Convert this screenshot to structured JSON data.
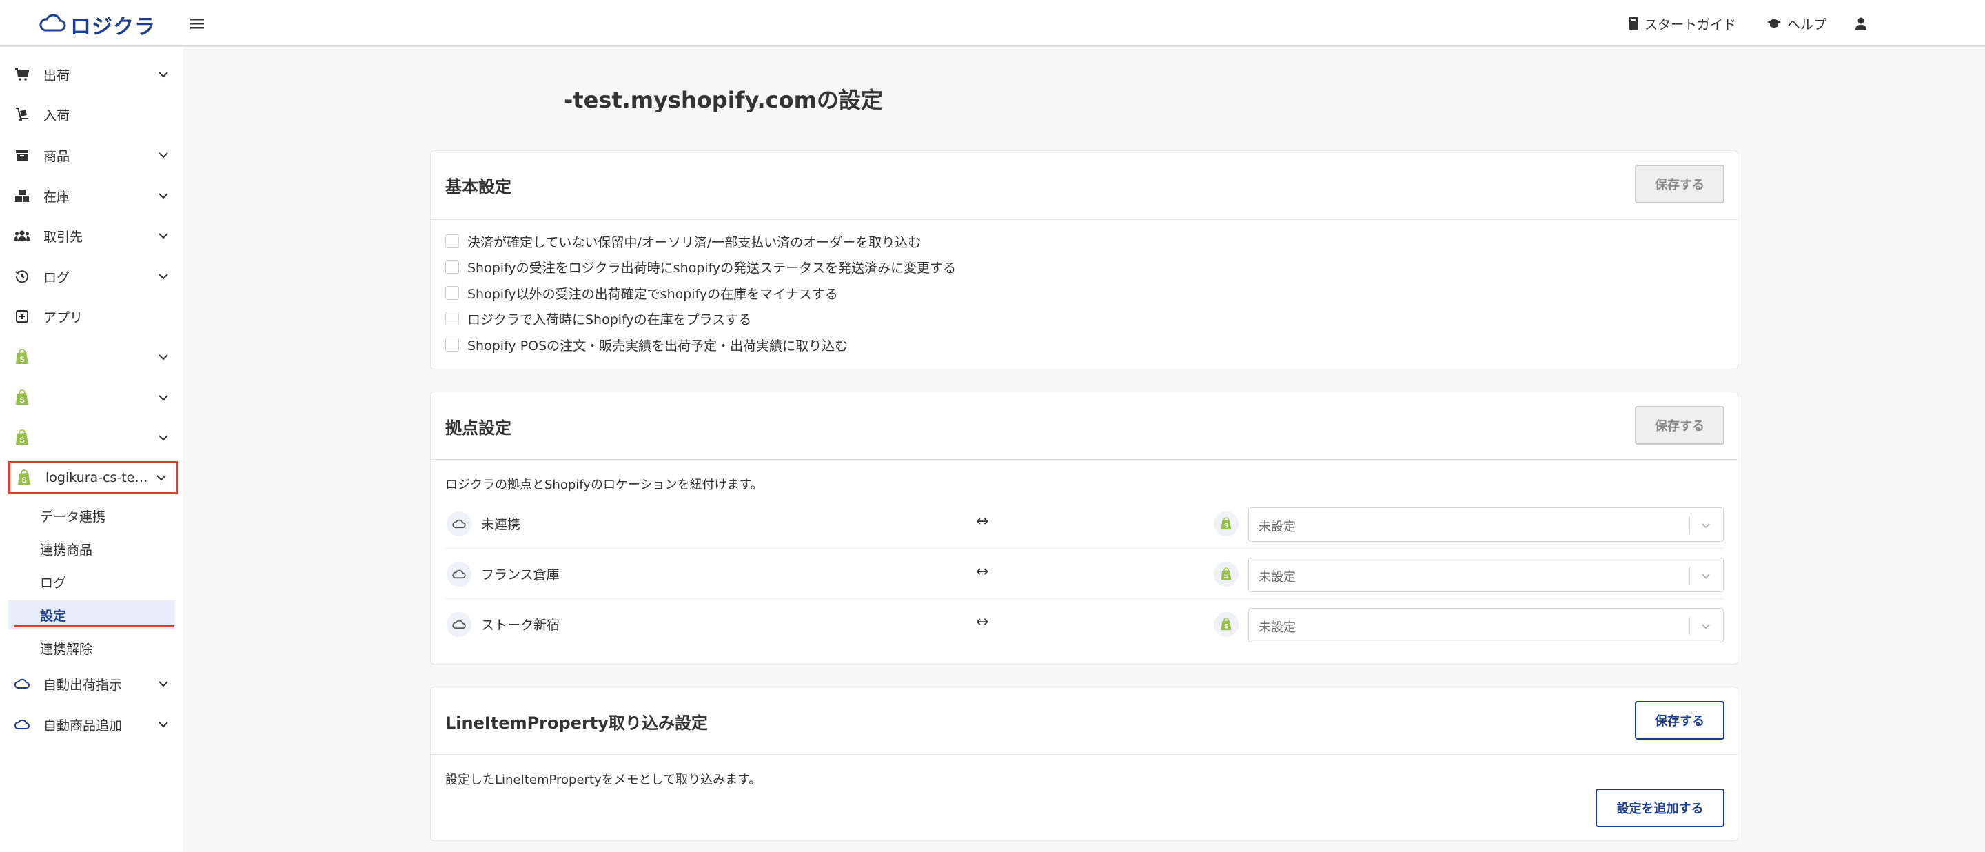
{
  "header": {
    "logo_text": "ロジクラ",
    "start_guide": "スタートガイド",
    "help": "ヘルプ"
  },
  "sidebar": {
    "items": [
      {
        "label": "出荷",
        "icon": "cart-icon",
        "chevron": true
      },
      {
        "label": "入荷",
        "icon": "dolly-icon",
        "chevron": false
      },
      {
        "label": "商品",
        "icon": "archive-box-icon",
        "chevron": true
      },
      {
        "label": "在庫",
        "icon": "boxes-icon",
        "chevron": true
      },
      {
        "label": "取引先",
        "icon": "people-icon",
        "chevron": true
      },
      {
        "label": "ログ",
        "icon": "history-icon",
        "chevron": true
      },
      {
        "label": "アプリ",
        "icon": "plus-square-icon",
        "chevron": false
      },
      {
        "label": "",
        "icon": "shopify-icon",
        "chevron": true
      },
      {
        "label": "",
        "icon": "shopify-icon",
        "chevron": true
      },
      {
        "label": "",
        "icon": "shopify-icon",
        "chevron": true
      },
      {
        "label": "logikura-cs-te…",
        "icon": "shopify-icon",
        "chevron": true
      }
    ],
    "sub_items": [
      "データ連携",
      "連携商品",
      "ログ",
      "設定",
      "連携解除"
    ],
    "bottom_items": [
      {
        "label": "自動出荷指示",
        "icon": "cloud-icon"
      },
      {
        "label": "自動商品追加",
        "icon": "cloud-icon"
      }
    ]
  },
  "page": {
    "title": "-test.myshopify.comの設定"
  },
  "basic": {
    "title": "基本設定",
    "save": "保存する",
    "options": [
      "決済が確定していない保留中/オーソリ済/一部支払い済のオーダーを取り込む",
      "Shopifyの受注をロジクラ出荷時にshopifyの発送ステータスを発送済みに変更する",
      "Shopify以外の受注の出荷確定でshopifyの在庫をマイナスする",
      "ロジクラで入荷時にShopifyの在庫をプラスする",
      "Shopify POSの注文・販売実績を出荷予定・出荷実績に取り込む"
    ]
  },
  "locations": {
    "title": "拠点設定",
    "save": "保存する",
    "description": "ロジクラの拠点とShopifyのロケーションを紐付けます。",
    "arrow": "↔",
    "rows": [
      {
        "name": "未連携",
        "select": "未設定"
      },
      {
        "name": "フランス倉庫",
        "select": "未設定"
      },
      {
        "name": "ストーク新宿",
        "select": "未設定"
      }
    ]
  },
  "lineitem": {
    "title": "LineItemProperty取り込み設定",
    "save": "保存する",
    "description": "設定したLineItemPropertyをメモとして取り込みます。",
    "add": "設定を追加する"
  },
  "colors": {
    "brand": "#1e3f8f",
    "highlight": "#e23b2e",
    "shopify_green": "#95bf47"
  }
}
